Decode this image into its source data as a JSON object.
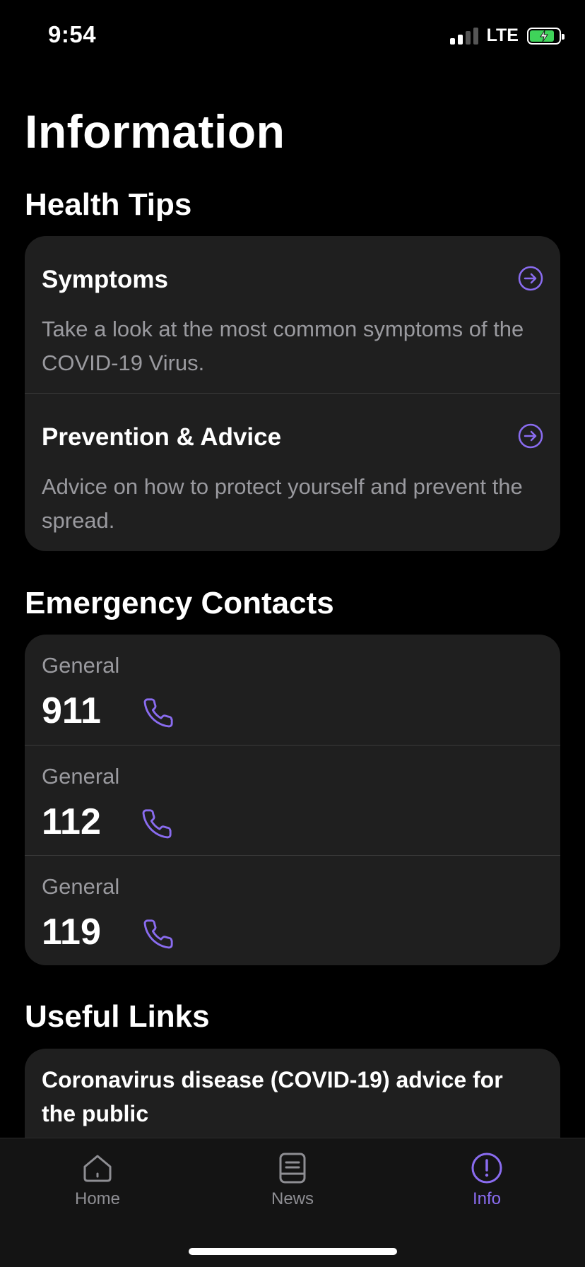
{
  "status_bar": {
    "time": "9:54",
    "network": "LTE"
  },
  "page": {
    "title": "Information"
  },
  "health_tips": {
    "section_title": "Health Tips",
    "items": [
      {
        "title": "Symptoms",
        "description": "Take a look at the most common symptoms of the COVID-19 Virus."
      },
      {
        "title": "Prevention & Advice",
        "description": "Advice on how to protect yourself and prevent the spread."
      }
    ]
  },
  "emergency": {
    "section_title": "Emergency Contacts",
    "contacts": [
      {
        "label": "General",
        "number": "911"
      },
      {
        "label": "General",
        "number": "112"
      },
      {
        "label": "General",
        "number": "119"
      }
    ]
  },
  "links": {
    "section_title": "Useful Links",
    "items": [
      {
        "title": "Coronavirus disease (COVID-19) advice for the public"
      }
    ]
  },
  "tab_bar": {
    "tabs": [
      {
        "label": "Home",
        "icon": "home-icon"
      },
      {
        "label": "News",
        "icon": "news-icon"
      },
      {
        "label": "Info",
        "icon": "info-icon",
        "active": true
      }
    ]
  },
  "colors": {
    "accent": "#8a6cf0",
    "card": "#1f1f1f",
    "secondary_text": "#9a9a9f",
    "background": "#000000"
  }
}
